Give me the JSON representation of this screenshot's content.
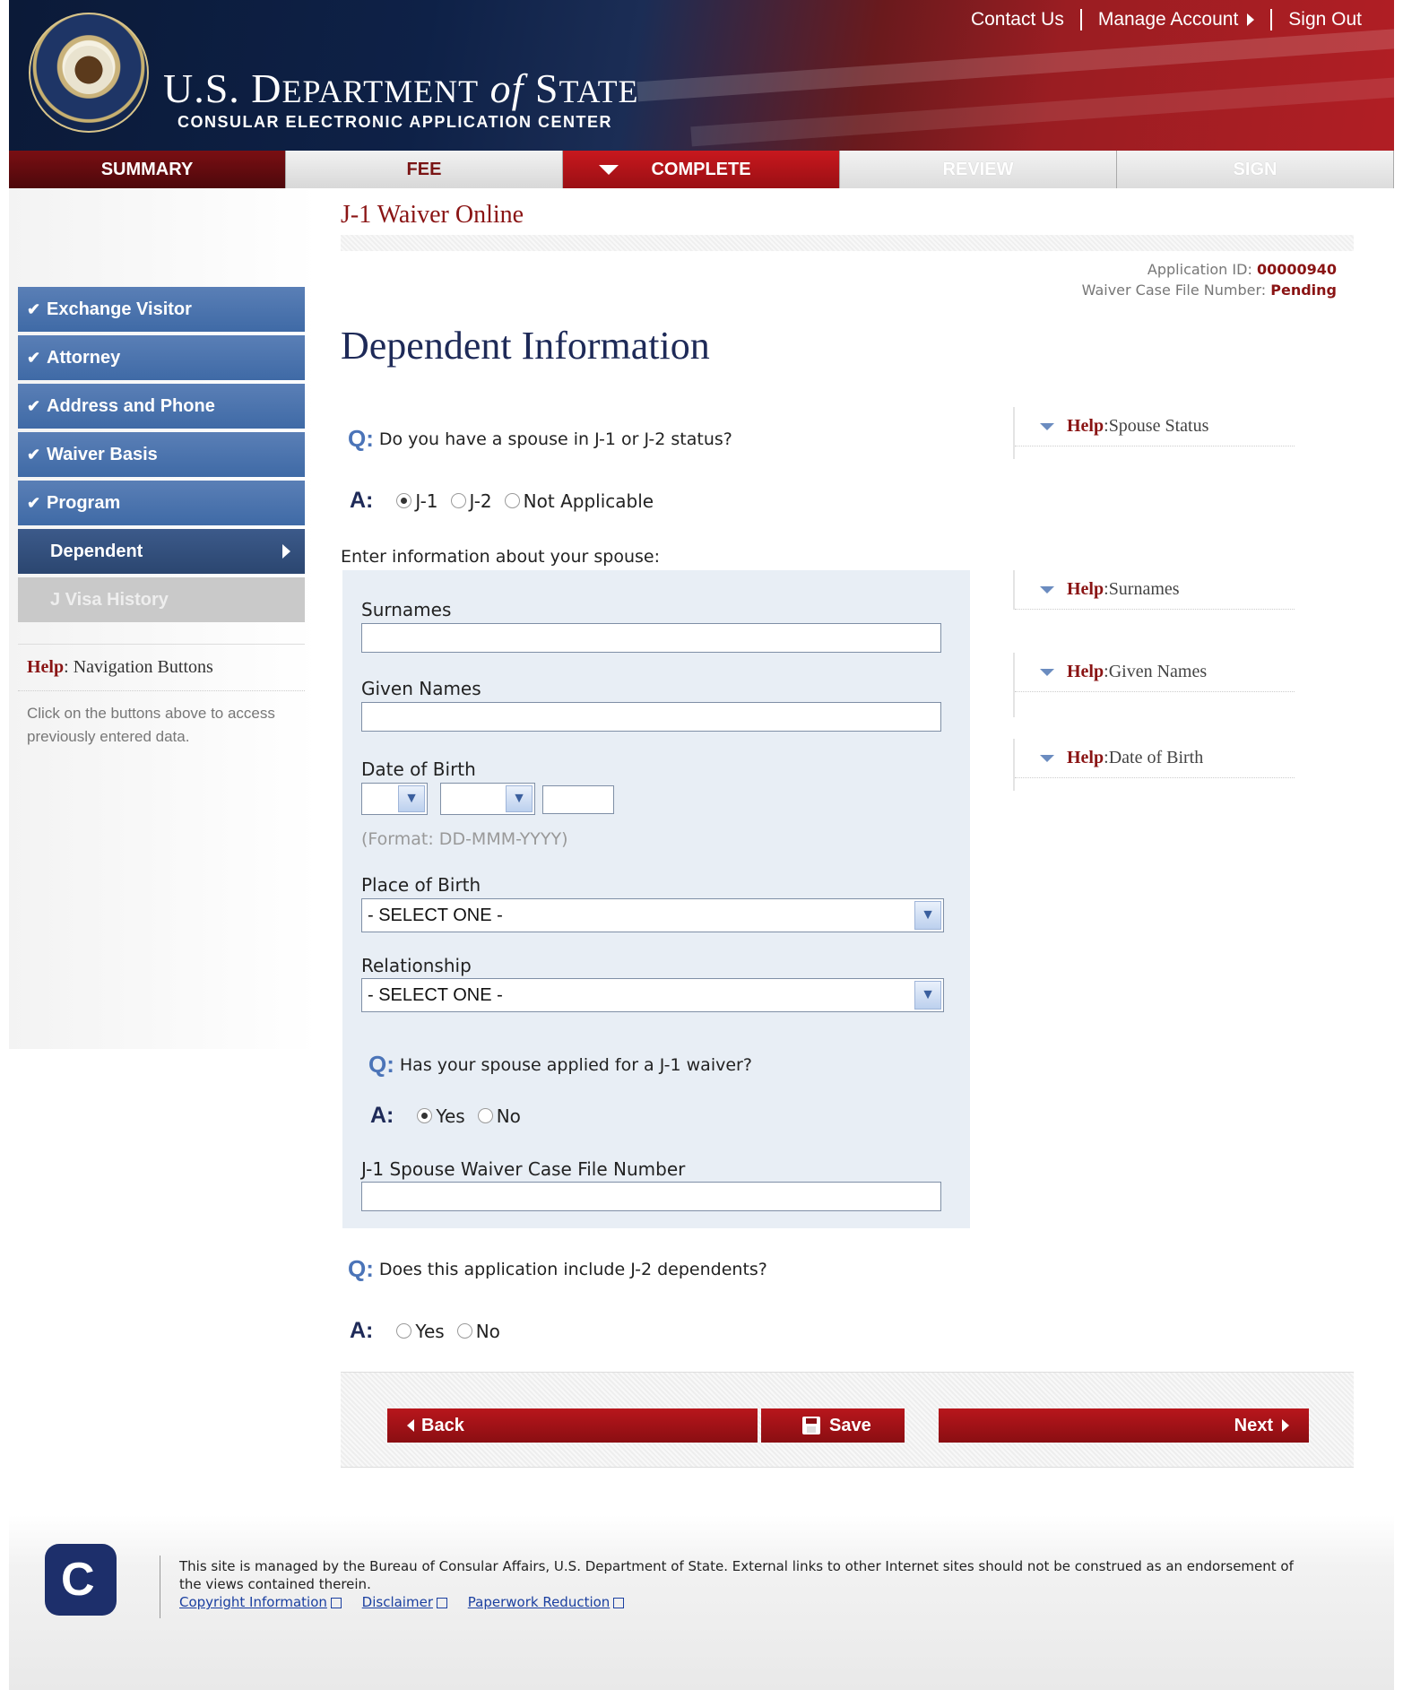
{
  "header": {
    "title_part1": "U.S. D",
    "title_part2": "EPARTMENT",
    "title_of": "of",
    "title_part3": "S",
    "title_part4": "TATE",
    "subtitle": "CONSULAR ELECTRONIC APPLICATION CENTER",
    "links": {
      "contact": "Contact Us",
      "manage": "Manage Account",
      "signout": "Sign Out"
    }
  },
  "steps": {
    "summary": "SUMMARY",
    "fee": "FEE",
    "complete": "COMPLETE",
    "review": "REVIEW",
    "sign": "SIGN"
  },
  "sidebar": {
    "items": [
      {
        "label": "Exchange Visitor"
      },
      {
        "label": "Attorney"
      },
      {
        "label": "Address and Phone"
      },
      {
        "label": "Waiver Basis"
      },
      {
        "label": "Program"
      },
      {
        "label": "Dependent"
      },
      {
        "label": "J Visa History"
      }
    ],
    "help": {
      "label": "Help",
      "title": "Navigation Buttons",
      "text": "Click on the buttons above to access previously entered data."
    }
  },
  "main": {
    "app_title": "J-1 Waiver Online",
    "app_id_label": "Application ID:",
    "app_id": "00000940",
    "case_label": "Waiver Case File Number:",
    "case_value": "Pending",
    "page_title": "Dependent Information",
    "q_prefix": "Q:",
    "a_prefix": "A:",
    "q1": "Do you have a spouse in J-1 or J-2 status?",
    "q1_options": [
      "J-1",
      "J-2",
      "Not Applicable"
    ],
    "q1_selected": "J-1",
    "enter_label": "Enter information about your spouse:",
    "surnames_label": "Surnames",
    "given_label": "Given Names",
    "dob_label": "Date of Birth",
    "dob_format": "(Format: DD-MMM-YYYY)",
    "pob_label": "Place of Birth",
    "pob_value": "- SELECT ONE -",
    "rel_label": "Relationship",
    "rel_value": "- SELECT ONE -",
    "q2": "Has your spouse applied for a J-1 waiver?",
    "q2_options": [
      "Yes",
      "No"
    ],
    "q2_selected": "Yes",
    "case_file_label": "J-1 Spouse Waiver Case File Number",
    "q3": "Does this application include J-2 dependents?",
    "q3_options": [
      "Yes",
      "No"
    ]
  },
  "help_panel": {
    "label": "Help",
    "items": [
      "Spouse Status",
      "Surnames",
      "Given Names",
      "Date of Birth"
    ]
  },
  "buttons": {
    "back": "Back",
    "save": "Save",
    "next": "Next"
  },
  "footer": {
    "text": "This site is managed by the Bureau of Consular Affairs, U.S. Department of State. External links to other Internet sites should not be construed as an endorsement of the views contained therein.",
    "links": [
      "Copyright Information",
      "Disclaimer",
      "Paperwork Reduction"
    ]
  }
}
